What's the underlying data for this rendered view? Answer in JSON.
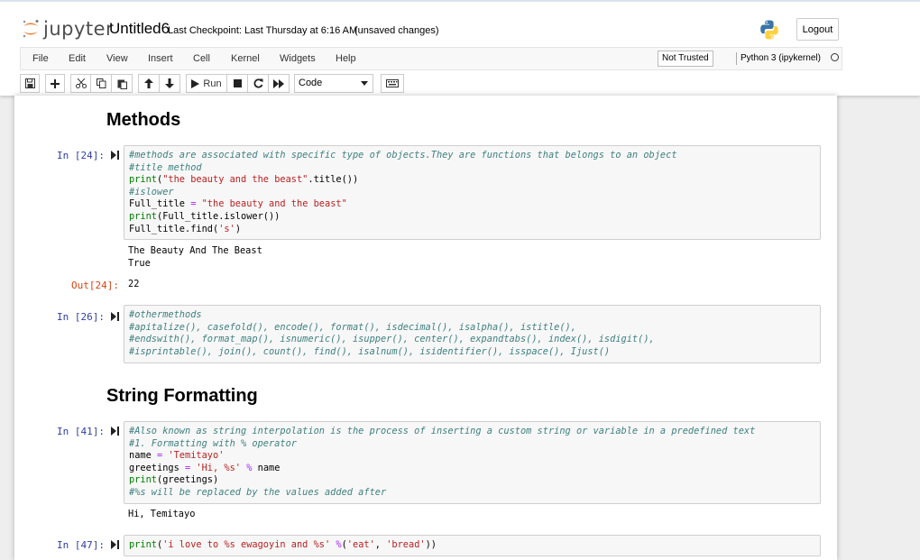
{
  "header": {
    "logo_text": "jupyter",
    "notebook_name": "Untitled6",
    "checkpoint": "Last Checkpoint: Last Thursday at 6:16 AM",
    "autosave_status": "(unsaved changes)",
    "logout_label": "Logout"
  },
  "menu": {
    "items": [
      "File",
      "Edit",
      "View",
      "Insert",
      "Cell",
      "Kernel",
      "Widgets",
      "Help"
    ],
    "trust_status": "Not Trusted",
    "kernel_name": "Python 3 (ipykernel)"
  },
  "toolbar": {
    "run_label": "Run",
    "cell_type": "Code",
    "icons": [
      "save-icon",
      "plus-icon",
      "cut-icon",
      "copy-icon",
      "paste-icon",
      "move-up-icon",
      "move-down-icon",
      "run-icon",
      "stop-icon",
      "restart-icon",
      "fast-forward-icon",
      "keyboard-icon"
    ]
  },
  "colors": {
    "logo_orange": "#f37726",
    "prompt_in": "#303f9f",
    "prompt_out": "#d84315",
    "comment": "#408080",
    "string": "#ba2121",
    "operator": "#aa22ff",
    "builtin": "#008000"
  },
  "cells": {
    "h_methods": "Methods",
    "c24": {
      "prompt": "In [24]:",
      "lines": [
        "#methods are associated with specific type of objects.They are functions that belongs to an object",
        "#title method",
        "print(\"the beauty and the beast\".title())",
        "#islower",
        "Full_title = \"the beauty and the beast\"",
        "print(Full_title.islower())",
        "Full_title.find('s')"
      ],
      "stdout": "The Beauty And The Beast\nTrue",
      "out_prompt": "Out[24]:",
      "out_value": "22"
    },
    "c26": {
      "prompt": "In [26]:",
      "lines": [
        "#othermethods",
        "#apitalize(), casefold(), encode(), format(), isdecimal(), isalpha(), istitle(),",
        "#endswith(), format_map(), isnumeric(), isupper(), center(), expandtabs(), index(), isdigit(),",
        "#isprintable(), join(), count(), find(), isalnum(), isidentifier(), isspace(), Ijust()"
      ]
    },
    "h_string_formatting": "String Formatting",
    "c41": {
      "prompt": "In [41]:",
      "lines": [
        "#Also known as string interpolation is the process of inserting a custom string or variable in a predefined text",
        "#1. Formatting with % operator",
        "name = 'Temitayo'",
        "greetings = 'Hi, %s' % name",
        "print(greetings)",
        "#%s will be replaced by the values added after"
      ],
      "stdout": "Hi, Temitayo"
    },
    "c47": {
      "prompt": "In [47]:",
      "lines": [
        "print('i love to %s ewagoyin and %s' %('eat', 'bread'))"
      ]
    }
  }
}
